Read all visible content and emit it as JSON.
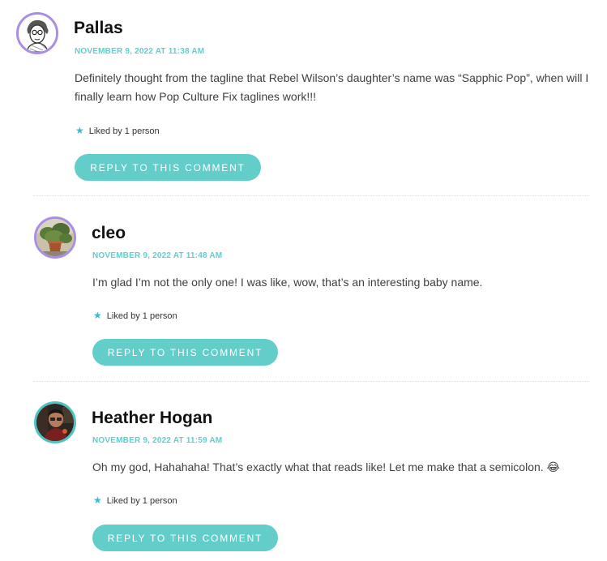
{
  "comments": [
    {
      "author": "Pallas",
      "avatar": "sketch-portrait-avatar",
      "timestamp": "NOVEMBER 9, 2022 AT 11:38 AM",
      "text": "Definitely thought from the tagline that Rebel Wilson’s daughter’s name was “Sapphic Pop”, when will I finally learn how Pop Culture Fix taglines work!!!",
      "likes": "Liked by 1 person",
      "reply_label": "REPLY TO THIS COMMENT"
    },
    {
      "author": "cleo",
      "avatar": "houseplant-photo-avatar",
      "timestamp": "NOVEMBER 9, 2022 AT 11:48 AM",
      "text": "I’m glad I’m not the only one! I was like, wow, that’s an interesting baby name.",
      "likes": "Liked by 1 person",
      "reply_label": "REPLY TO THIS COMMENT"
    },
    {
      "author": "Heather Hogan",
      "avatar": "person-photo-avatar",
      "timestamp": "NOVEMBER 9, 2022 AT 11:59 AM",
      "text": "Oh my god, Hahahaha! That’s exactly what that reads like! Let me make that a semicolon. 😂",
      "likes": "Liked by 1 person",
      "reply_label": "REPLY TO THIS COMMENT"
    }
  ],
  "colors": {
    "accent": "#62cdc9",
    "timestamp": "#5fcfcd",
    "avatar_ring_purple": "#a98ee6",
    "avatar_ring_teal": "#4ec4c0",
    "star": "#3fb8c9"
  }
}
